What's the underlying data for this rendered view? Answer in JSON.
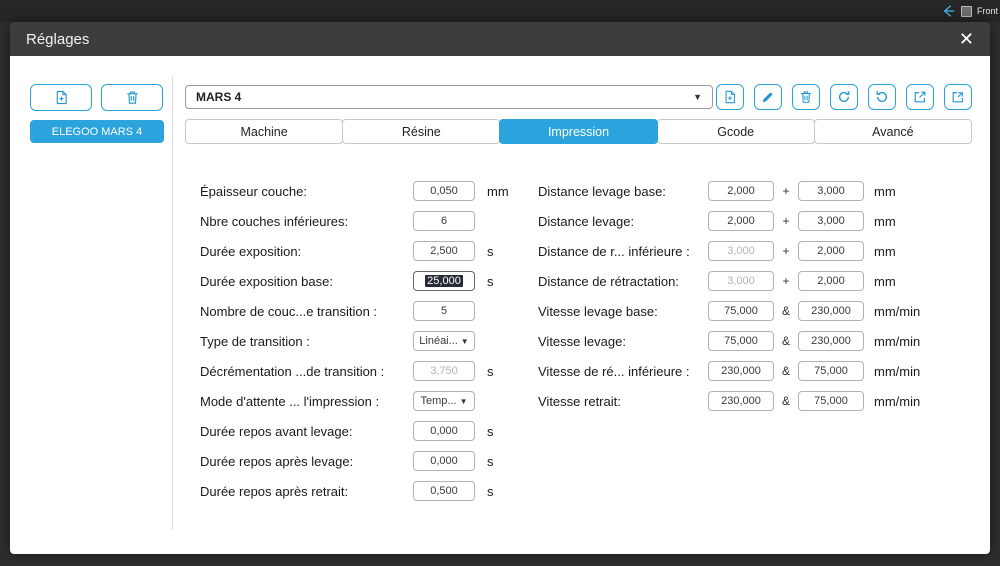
{
  "screen": {
    "front_label": "Front"
  },
  "glyphs": {
    "chevron_down": "▼",
    "close": "✕"
  },
  "colors": {
    "accent": "#2ba3dc",
    "selection_bg": "#262b36"
  },
  "window": {
    "title": "Réglages"
  },
  "sidebar": {
    "printer_name": "ELEGOO MARS 4"
  },
  "toolbar": {
    "profile_name": "MARS 4",
    "icons": [
      "new-profile",
      "edit-profile",
      "delete-profile",
      "refresh-profile",
      "restore-defaults",
      "export-profile",
      "import-profile"
    ]
  },
  "tabs": [
    {
      "id": "machine",
      "label": "Machine",
      "active": false
    },
    {
      "id": "resine",
      "label": "Résine",
      "active": false
    },
    {
      "id": "impression",
      "label": "Impression",
      "active": true
    },
    {
      "id": "gcode",
      "label": "Gcode",
      "active": false
    },
    {
      "id": "avance",
      "label": "Avancé",
      "active": false
    }
  ],
  "form": {
    "left_rows": [
      {
        "label": "Épaisseur couche:",
        "value": "0,050",
        "unit": "mm"
      },
      {
        "label": "Nbre couches inférieures:",
        "value": "6",
        "unit": ""
      },
      {
        "label": "Durée exposition:",
        "value": "2,500",
        "unit": "s"
      },
      {
        "label": "Durée exposition base:",
        "value": "25,000",
        "unit": "s",
        "state": "selected"
      },
      {
        "label": "Nombre de couc...e transition :",
        "value": "5",
        "unit": ""
      },
      {
        "label": "Type de transition :",
        "value": "Linéai...",
        "unit": "",
        "type": "select"
      },
      {
        "label": "Décrémentation ...de transition :",
        "value": "3,750",
        "unit": "s",
        "state": "disabled"
      },
      {
        "label": "Mode d'attente ... l'impression :",
        "value": "Temp...",
        "unit": "",
        "type": "select"
      },
      {
        "label": "Durée repos avant levage:",
        "value": "0,000",
        "unit": "s"
      },
      {
        "label": "Durée repos après levage:",
        "value": "0,000",
        "unit": "s"
      },
      {
        "label": "Durée repos après retrait:",
        "value": "0,500",
        "unit": "s"
      }
    ],
    "right_rows": [
      {
        "label": "Distance levage base:",
        "value1": "2,000",
        "sep": "+",
        "value2": "3,000",
        "unit": "mm"
      },
      {
        "label": "Distance levage:",
        "value1": "2,000",
        "sep": "+",
        "value2": "3,000",
        "unit": "mm"
      },
      {
        "label": "Distance de r... inférieure :",
        "value1": "3,000",
        "sep": "+",
        "value2": "2,000",
        "unit": "mm",
        "state1": "disabled"
      },
      {
        "label": "Distance de rétractation:",
        "value1": "3,000",
        "sep": "+",
        "value2": "2,000",
        "unit": "mm",
        "state1": "disabled"
      },
      {
        "label": "Vitesse levage base:",
        "value1": "75,000",
        "sep": "&",
        "value2": "230,000",
        "unit": "mm/min"
      },
      {
        "label": "Vitesse levage:",
        "value1": "75,000",
        "sep": "&",
        "value2": "230,000",
        "unit": "mm/min"
      },
      {
        "label": "Vitesse de ré... inférieure :",
        "value1": "230,000",
        "sep": "&",
        "value2": "75,000",
        "unit": "mm/min"
      },
      {
        "label": "Vitesse retrait:",
        "value1": "230,000",
        "sep": "&",
        "value2": "75,000",
        "unit": "mm/min"
      }
    ]
  }
}
